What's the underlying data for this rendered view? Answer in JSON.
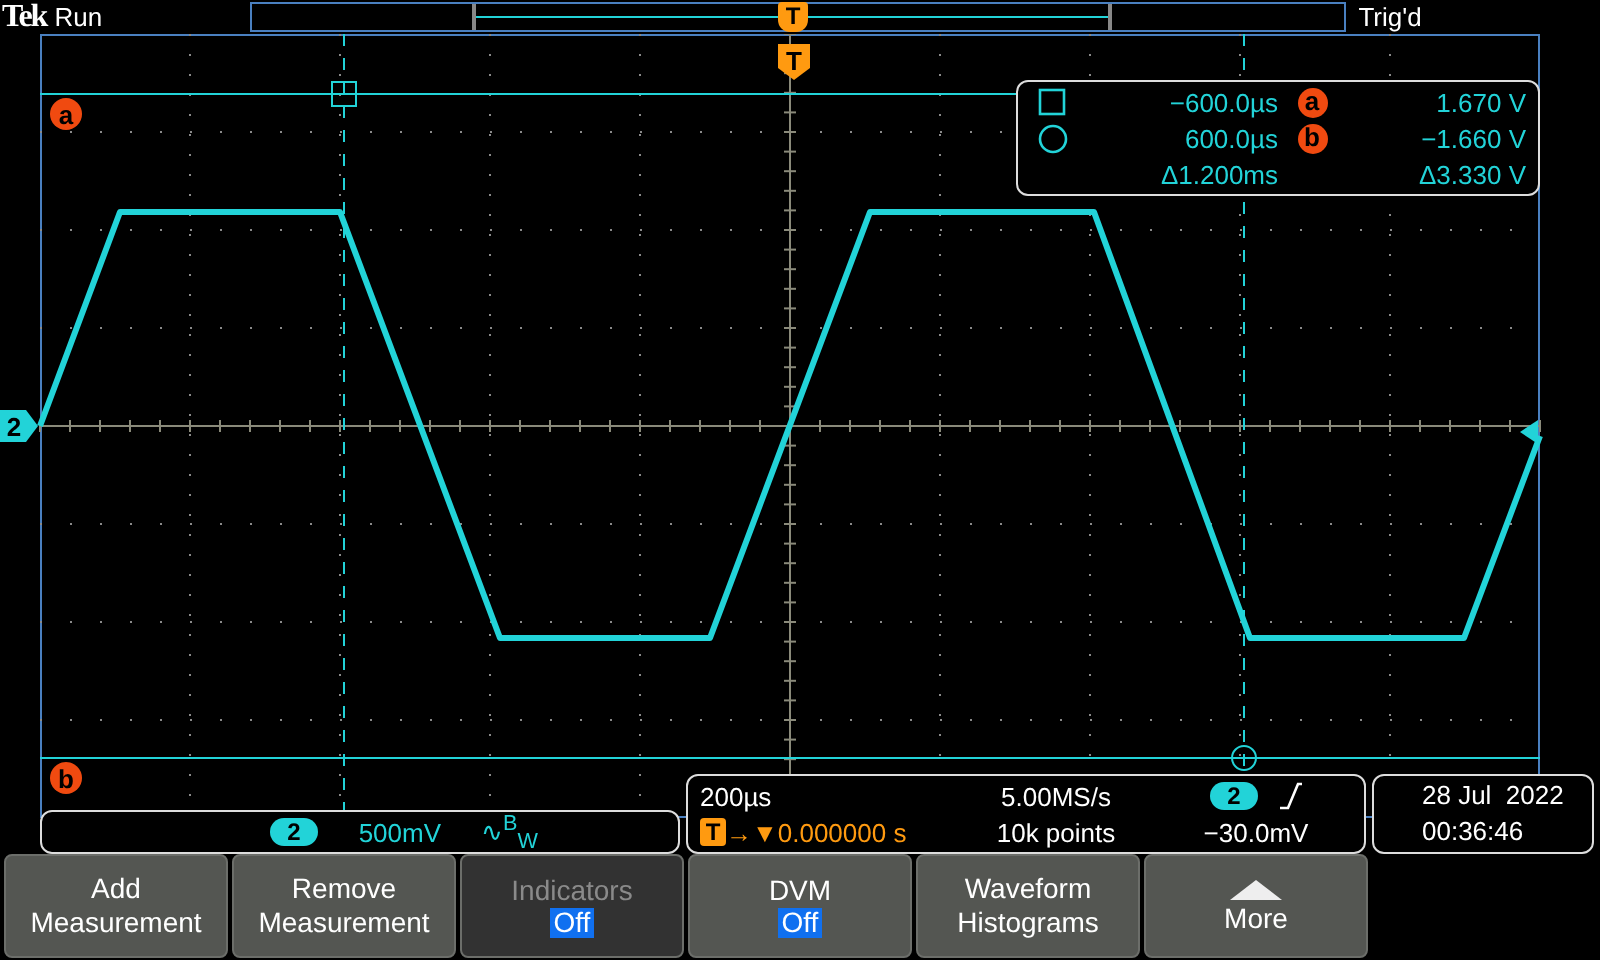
{
  "status": {
    "brand": "Tek",
    "acquisition": "Run",
    "trigger_marker": "T",
    "trigger_state": "Trig'd"
  },
  "graticule": {
    "trigger_marker": "T",
    "channel_marker": "2",
    "cursors": [
      {
        "label": "a"
      },
      {
        "label": "b"
      }
    ]
  },
  "cursor_readout": {
    "rows": [
      {
        "kind": "square",
        "time": "−600.0µs",
        "label": "a",
        "value": "1.670 V"
      },
      {
        "kind": "circle",
        "time": "600.0µs",
        "label": "b",
        "value": "−1.660 V"
      },
      {
        "kind": "delta",
        "time": "Δ1.200ms",
        "value": "Δ3.330 V"
      }
    ]
  },
  "channel_box": {
    "channel": "2",
    "scale": "500mV",
    "bandwidth": "∿$^{B}$$_{W}$"
  },
  "horizontal_box": {
    "time_scale": "200µs",
    "trigger_badge": "T",
    "position_arrows": "→▼",
    "position": "0.000000 s",
    "sample_rate": "5.00MS/s",
    "record_length": "10k points",
    "trigger_channel": "2",
    "trigger_level": "−30.0mV"
  },
  "date_box": {
    "date": "28 Jul  2022",
    "time": "00:36:46"
  },
  "buttons": [
    {
      "kind": "action",
      "lines": [
        "Add",
        "Measurement"
      ],
      "disabled": false
    },
    {
      "kind": "action",
      "lines": [
        "Remove",
        "Measurement"
      ],
      "disabled": false
    },
    {
      "kind": "toggle",
      "lines": [
        "Indicators"
      ],
      "value": "Off",
      "disabled": true
    },
    {
      "kind": "toggle",
      "lines": [
        "DVM"
      ],
      "value": "Off",
      "disabled": false
    },
    {
      "kind": "action",
      "lines": [
        "Waveform",
        "Histograms"
      ],
      "disabled": false
    },
    {
      "kind": "menu",
      "lines": [
        "More"
      ],
      "disabled": false
    }
  ]
}
